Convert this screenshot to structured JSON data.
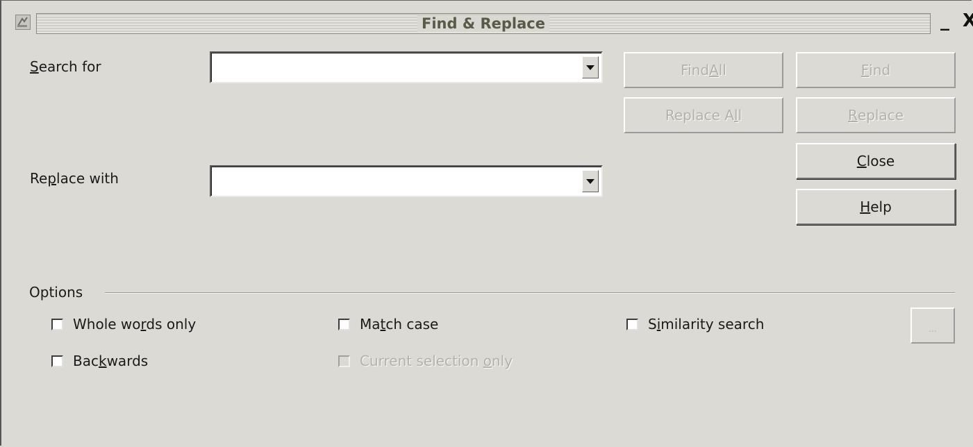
{
  "window": {
    "title": "Find & Replace",
    "minimize_glyph": "_",
    "close_glyph": "X",
    "icon": "app-icon"
  },
  "search": {
    "label_prefix": "",
    "label_accel": "S",
    "label_rest": "earch for",
    "value": ""
  },
  "replace": {
    "label_prefix": "Re",
    "label_accel": "p",
    "label_rest": "lace with",
    "value": ""
  },
  "buttons": {
    "find_all": {
      "prefix": "Find ",
      "accel": "A",
      "rest": "ll",
      "enabled": false
    },
    "find": {
      "prefix": "",
      "accel": "F",
      "rest": "ind",
      "enabled": false
    },
    "replace_all": {
      "prefix": "Replace A",
      "accel": "l",
      "rest": "l",
      "enabled": false
    },
    "replace": {
      "prefix": "",
      "accel": "R",
      "rest": "eplace",
      "enabled": false
    },
    "close": {
      "prefix": "",
      "accel": "C",
      "rest": "lose",
      "enabled": true
    },
    "help": {
      "prefix": "",
      "accel": "H",
      "rest": "elp",
      "enabled": true
    },
    "more": {
      "label": "...",
      "enabled": false
    }
  },
  "options": {
    "title": "Options",
    "whole_words": {
      "prefix": "Whole wo",
      "accel": "r",
      "rest": "ds only",
      "checked": false,
      "enabled": true
    },
    "match_case": {
      "prefix": "Ma",
      "accel": "t",
      "rest": "ch case",
      "checked": false,
      "enabled": true
    },
    "similarity": {
      "prefix": "S",
      "accel": "i",
      "rest": "milarity search",
      "checked": false,
      "enabled": true
    },
    "backwards": {
      "prefix": "Bac",
      "accel": "k",
      "rest": "wards",
      "checked": false,
      "enabled": true
    },
    "current_selection": {
      "prefix": "Current selection ",
      "accel": "o",
      "rest": "nly",
      "checked": false,
      "enabled": false
    }
  },
  "colors": {
    "background": "#dcdad5",
    "disabled_text": "#b3b1ac",
    "title_text": "#5a5a48"
  }
}
